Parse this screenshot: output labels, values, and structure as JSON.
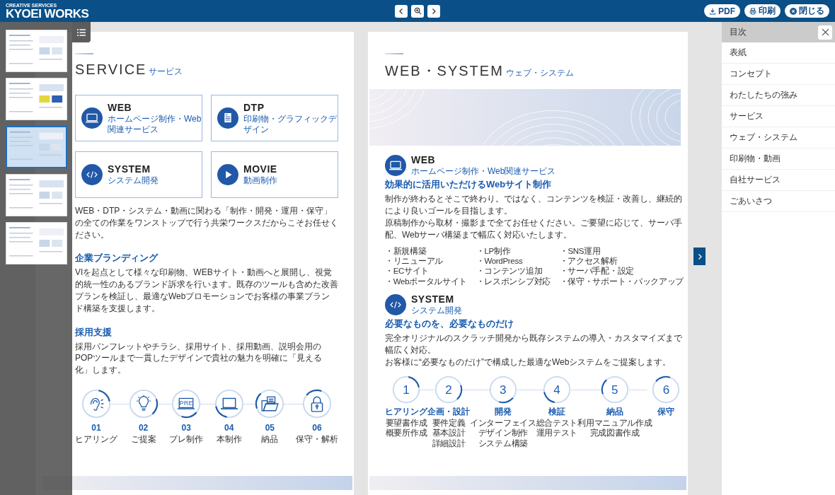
{
  "header": {
    "tagline": "CREATIVE SERVICES",
    "logo": "KYOEI WORKS",
    "actions": [
      {
        "label": "PDF"
      },
      {
        "label": "印刷"
      },
      {
        "label": "閉じる"
      }
    ]
  },
  "thumbnails": [
    {
      "selected": false
    },
    {
      "selected": false
    },
    {
      "selected": true
    },
    {
      "selected": false
    },
    {
      "selected": false
    }
  ],
  "left_page": {
    "title": "SERVICE",
    "subtitle": "サービス",
    "cards": [
      {
        "title": "WEB",
        "caption": "ホームページ制作・Web関連サービス"
      },
      {
        "title": "DTP",
        "caption": "印刷物・グラフィックデザイン"
      },
      {
        "title": "SYSTEM",
        "caption": "システム開発"
      },
      {
        "title": "MOVIE",
        "caption": "動画制作"
      }
    ],
    "intro": "WEB・DTP・システム・動画に関わる「制作・開発・運用・保守」の全ての作業をワンストップで行う共栄ワークスだからこそお任せください。",
    "sections": [
      {
        "heading": "企業ブランディング",
        "body": "VIを起点として様々な印刷物、WEBサイト・動画へと展開し、視覚的統一性のあるブランド訴求を行います。既存のツールも含めた改善プランを検証し、最適なWebプロモーションでお客様の事業ブランド構築を支援します。"
      },
      {
        "heading": "採用支援",
        "body": "採用パンフレットやチラシ、採用サイト、採用動画、説明会用のPOPツールまで一貫したデザインで貴社の魅力を明確に「見える化」します。"
      }
    ],
    "steps": [
      {
        "number": "01",
        "label": "ヒアリング"
      },
      {
        "number": "02",
        "label": "ご提案"
      },
      {
        "screen_text": "PRE",
        "number": "03",
        "label": "プレ制作"
      },
      {
        "number": "04",
        "label": "本制作"
      },
      {
        "number": "05",
        "label": "納品"
      },
      {
        "number": "06",
        "label": "保守・解析"
      }
    ]
  },
  "right_page": {
    "title": "WEB・SYSTEM",
    "subtitle": "ウェブ・システム",
    "sections": [
      {
        "title": "WEB",
        "caption": "ホームページ制作・Web関連サービス",
        "heading": "効果的に活用いただけるWebサイト制作",
        "body_lines": [
          "制作が終わるとそこで終わり。ではなく、コンテンツを検証・改善し、継続的により良いゴールを目指します。",
          "原稿制作から取材・撮影まで全てお任せください。ご要望に応じて、サーバ手配、Webサーバ構築まで幅広く対応いたします。"
        ],
        "features": [
          [
            "・新規構築",
            "・リニューアル",
            "・ECサイト",
            "・Webポータルサイト"
          ],
          [
            "・LP制作",
            "・WordPress",
            "・コンテンツ追加",
            "・レスポンシブ対応"
          ],
          [
            "・SNS運用",
            "・アクセス解析",
            "・サーバ手配・設定",
            "・保守・サポート・バックアップ"
          ]
        ]
      },
      {
        "title": "SYSTEM",
        "caption": "システム開発",
        "heading": "必要なものを、必要なものだけ",
        "body_lines": [
          "完全オリジナルのスクラッチ開発から既存システムの導入・カスタマイズまで幅広く対応。",
          "お客様に“必要なものだけ”で構成した最適なWebシステムをご提案します。"
        ]
      }
    ],
    "steps": [
      {
        "number": "1",
        "title": "ヒアリング",
        "lines": [
          "要望書作成",
          "概要所作成"
        ]
      },
      {
        "number": "2",
        "title": "企画・設計",
        "lines": [
          "要件定義",
          "基本設計",
          "詳細設計"
        ]
      },
      {
        "number": "3",
        "title": "開発",
        "lines": [
          "インターフェイス",
          "デザイン制作",
          "システム構築"
        ]
      },
      {
        "number": "4",
        "title": "検証",
        "lines": [
          "総合テスト",
          "運用テスト"
        ]
      },
      {
        "number": "5",
        "title": "納品",
        "lines": [
          "利用マニュアル作成",
          "完成図書作成"
        ]
      },
      {
        "number": "6",
        "title": "保守"
      }
    ]
  },
  "toc": {
    "title": "目次",
    "items": [
      "表紙",
      "コンセプト",
      "わたしたちの強み",
      "サービス",
      "ウェブ・システム",
      "印刷物・動画",
      "自社サービス",
      "ごあいさつ"
    ]
  }
}
